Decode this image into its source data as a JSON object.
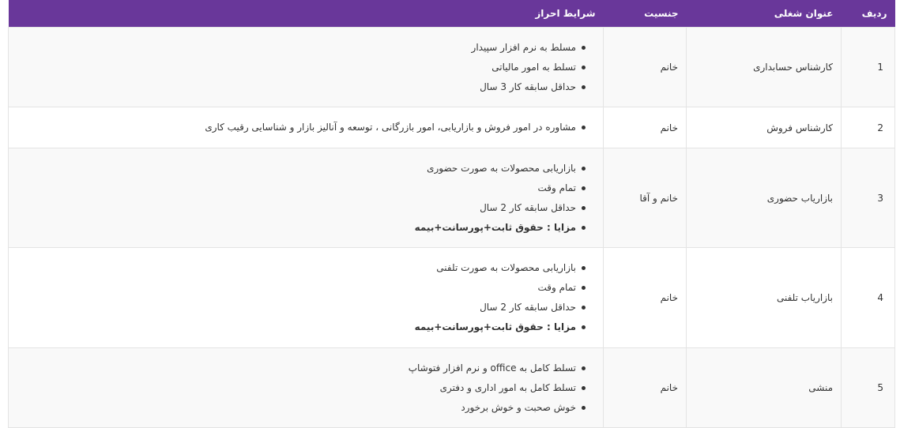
{
  "table": {
    "headers": {
      "row": "ردیف",
      "title": "عنوان شغلی",
      "gender": "جنسیت",
      "requirements": "شرایط احراز"
    },
    "rows": [
      {
        "num": "1",
        "title": "کارشناس حسابداری",
        "gender": "خانم",
        "requirements": [
          "مسلط به نرم افزار سپیدار",
          "تسلط به امور مالیاتی",
          "حداقل سابقه کار 3 سال"
        ]
      },
      {
        "num": "2",
        "title": "کارشناس فروش",
        "gender": "خانم",
        "requirements": [
          "مشاوره در امور فروش و بازاریابی، امور بازرگانی ، توسعه و آنالیز بازار و شناسایی رقیب کاری"
        ]
      },
      {
        "num": "3",
        "title": "بازاریاب حضوری",
        "gender": "خانم و آقا",
        "requirements": [
          "بازاریابی محصولات به صورت حضوری",
          "تمام وقت",
          "حداقل سابقه کار 2 سال",
          "مزایا : حقوق ثابت+پورسانت+بیمه"
        ]
      },
      {
        "num": "4",
        "title": "بازاریاب تلفنی",
        "gender": "خانم",
        "requirements": [
          "بازاریابی محصولات به صورت تلفنی",
          "تمام وقت",
          "حداقل سابقه کار 2 سال",
          "مزایا : حقوق ثابت+پورسانت+بیمه"
        ]
      },
      {
        "num": "5",
        "title": "منشی",
        "gender": "خانم",
        "requirements": [
          "تسلط کامل به office و نرم افزار فتوشاپ",
          "تسلط کامل به امور اداری و دفتری",
          "خوش صحبت و خوش برخورد"
        ]
      }
    ]
  },
  "colors": {
    "header_bg": "#69379a",
    "header_text": "#ffffff",
    "row_alt_bg": "#f9f9f9"
  }
}
